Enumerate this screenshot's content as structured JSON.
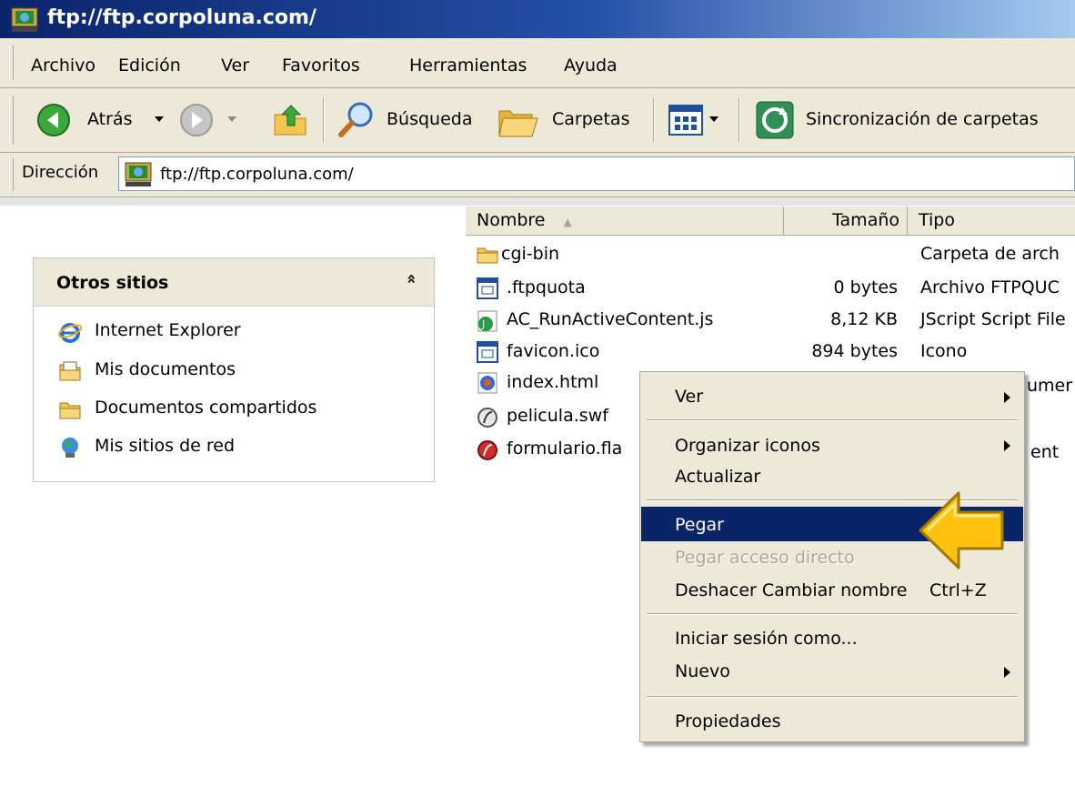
{
  "window": {
    "title": "ftp://ftp.corpoluna.com/"
  },
  "menu": {
    "items": [
      "Archivo",
      "Edición",
      "Ver",
      "Favoritos",
      "Herramientas",
      "Ayuda"
    ]
  },
  "toolbar": {
    "back_label": "Atrás",
    "search_label": "Búsqueda",
    "folders_label": "Carpetas",
    "sync_label": "Sincronización de carpetas"
  },
  "address": {
    "label": "Dirección",
    "value": "ftp://ftp.corpoluna.com/"
  },
  "other_places": {
    "title": "Otros sitios",
    "collapse_glyph": "»",
    "items": [
      "Internet Explorer",
      "Mis documentos",
      "Documentos compartidos",
      "Mis sitios de red"
    ]
  },
  "file_list": {
    "columns": {
      "name": "Nombre",
      "size": "Tamaño",
      "type": "Tipo"
    },
    "sort_glyph": "▲",
    "rows": [
      {
        "name": "cgi-bin",
        "size": "",
        "type": "Carpeta de arch"
      },
      {
        "name": ".ftpquota",
        "size": "0 bytes",
        "type": "Archivo FTPQUC"
      },
      {
        "name": "AC_RunActiveContent.js",
        "size": "8,12 KB",
        "type": "JScript Script File"
      },
      {
        "name": "favicon.ico",
        "size": "894 bytes",
        "type": "Icono"
      },
      {
        "name": "index.html",
        "size": "",
        "type": "umer"
      },
      {
        "name": "pelicula.swf",
        "size": "",
        "type": ""
      },
      {
        "name": "formulario.fla",
        "size": "",
        "type": "ent"
      }
    ]
  },
  "context_menu": {
    "ver": "Ver",
    "organizar": "Organizar iconos",
    "actualizar": "Actualizar",
    "pegar": "Pegar",
    "pegar_acceso": "Pegar acceso directo",
    "deshacer": "Deshacer Cambiar nombre",
    "deshacer_shortcut": "Ctrl+Z",
    "iniciar_sesion": "Iniciar sesión como...",
    "nuevo": "Nuevo",
    "propiedades": "Propiedades"
  },
  "colors": {
    "title_bar": "#0a246a",
    "highlight": "#0a246a",
    "callout_arrow": "#ffc20e",
    "disabled_text": "#aca899"
  }
}
